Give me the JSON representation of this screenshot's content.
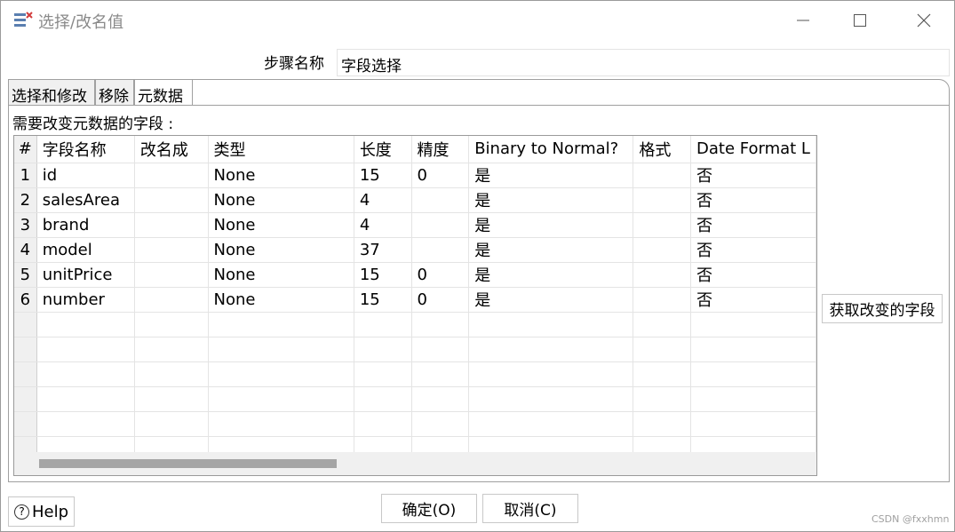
{
  "window": {
    "title": "选择/改名值"
  },
  "step": {
    "label": "步骤名称",
    "value": "字段选择"
  },
  "tabs": [
    {
      "label": "选择和修改",
      "active": false
    },
    {
      "label": "移除",
      "active": false
    },
    {
      "label": "元数据",
      "active": true
    }
  ],
  "section": {
    "label": "需要改变元数据的字段 :"
  },
  "table": {
    "columns": [
      "#",
      "字段名称",
      "改名成",
      "类型",
      "长度",
      "精度",
      "Binary to Normal?",
      "格式",
      "Date Format L"
    ],
    "rows": [
      [
        "1",
        "id",
        "",
        "None",
        "15",
        "0",
        "是",
        "",
        "否"
      ],
      [
        "2",
        "salesArea",
        "",
        "None",
        "4",
        "",
        "是",
        "",
        "否"
      ],
      [
        "3",
        "brand",
        "",
        "None",
        "4",
        "",
        "是",
        "",
        "否"
      ],
      [
        "4",
        "model",
        "",
        "None",
        "37",
        "",
        "是",
        "",
        "否"
      ],
      [
        "5",
        "unitPrice",
        "",
        "None",
        "15",
        "0",
        "是",
        "",
        "否"
      ],
      [
        "6",
        "number",
        "",
        "None",
        "15",
        "0",
        "是",
        "",
        "否"
      ]
    ],
    "empty_rows": 6
  },
  "buttons": {
    "get_fields": "获取改变的字段",
    "help": "Help",
    "ok": "确定(O)",
    "cancel": "取消(C)"
  },
  "watermark": "CSDN @fxxhmn",
  "icons": {
    "app": "select-values-icon",
    "help": "help-circle-icon"
  }
}
